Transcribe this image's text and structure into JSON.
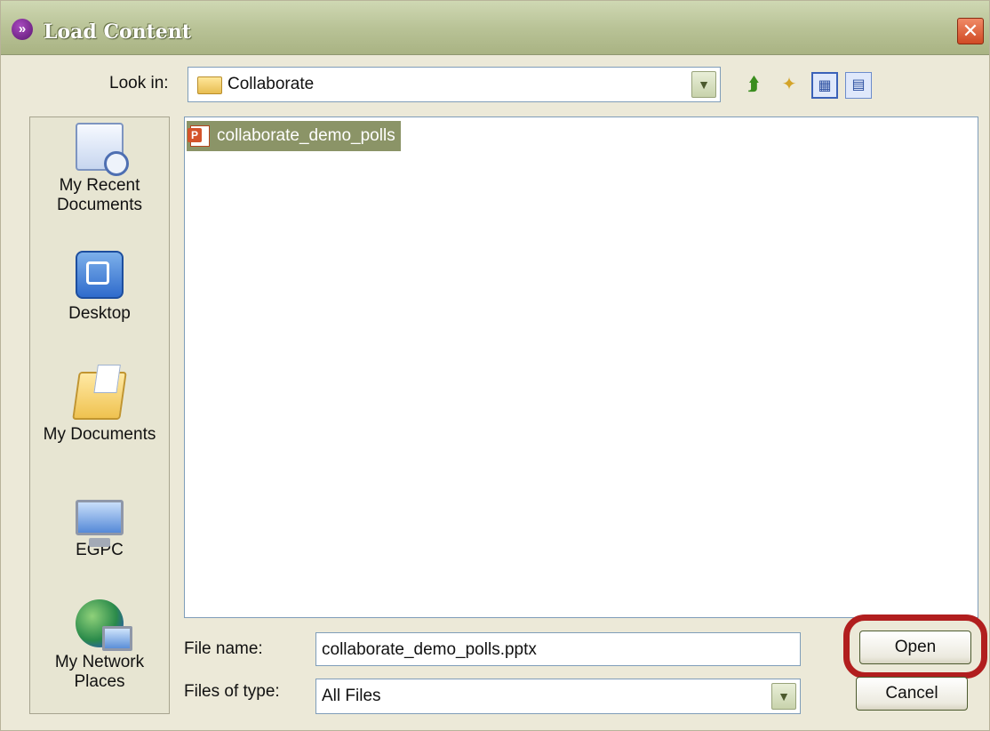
{
  "window": {
    "title": "Load Content",
    "close_symbol": "✕",
    "title_icon": "collaborate-app-icon"
  },
  "toolbar": {
    "look_in_label": "Look in:",
    "look_in_value": "Collaborate",
    "dropdown_symbol": "▼",
    "buttons": [
      {
        "name": "up-one-level-icon",
        "glyph": "⮭"
      },
      {
        "name": "create-new-folder-icon",
        "glyph": "✦"
      },
      {
        "name": "list-view-icon",
        "glyph": "▦"
      },
      {
        "name": "details-view-icon",
        "glyph": "▤"
      }
    ]
  },
  "places": [
    {
      "label": "My Recent Documents",
      "icon": "recent-documents-icon"
    },
    {
      "label": "Desktop",
      "icon": "desktop-icon"
    },
    {
      "label": "My Documents",
      "icon": "my-documents-icon"
    },
    {
      "label": "EGPC",
      "icon": "computer-icon"
    },
    {
      "label": "My Network Places",
      "icon": "network-places-icon"
    }
  ],
  "files": [
    {
      "name": "collaborate_demo_polls",
      "icon": "powerpoint-file-icon",
      "selected": true
    }
  ],
  "footer": {
    "file_name_label": "File name:",
    "file_name_value": "collaborate_demo_polls.pptx",
    "file_type_label": "Files of type:",
    "file_type_value": "All Files",
    "open_label": "Open",
    "cancel_label": "Cancel"
  },
  "colors": {
    "highlight_ring": "#b11e1e",
    "selection": "#8b9467",
    "titlebar": "#b9c397"
  }
}
